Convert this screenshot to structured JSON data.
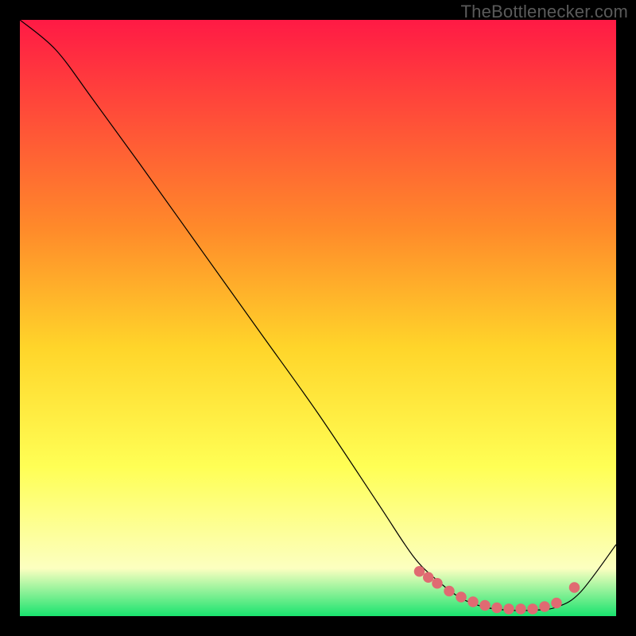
{
  "watermark": "TheBottlenecker.com",
  "colors": {
    "black": "#000000",
    "line": "#000000",
    "dot": "#e06a72",
    "grad_top": "#ff1a45",
    "grad_mid_upper": "#ff8a2a",
    "grad_mid": "#ffd52a",
    "grad_mid_lower": "#ffff55",
    "grad_low": "#fcffc0",
    "grad_bottom": "#19e36e"
  },
  "chart_data": {
    "type": "line",
    "title": "",
    "xlabel": "",
    "ylabel": "",
    "xlim": [
      0,
      100
    ],
    "ylim": [
      0,
      100
    ],
    "grid": false,
    "legend": false,
    "series": [
      {
        "name": "curve",
        "x": [
          0,
          6,
          12,
          20,
          30,
          40,
          50,
          60,
          66,
          70,
          74,
          78,
          82,
          86,
          90,
          94,
          100
        ],
        "y": [
          100,
          95,
          87,
          76,
          62,
          48,
          34,
          19,
          10,
          6,
          3,
          1.5,
          1,
          1,
          1.5,
          4,
          12
        ]
      }
    ],
    "markers": {
      "name": "dots",
      "x": [
        67,
        68.5,
        70,
        72,
        74,
        76,
        78,
        80,
        82,
        84,
        86,
        88,
        90,
        93
      ],
      "y": [
        7.5,
        6.5,
        5.5,
        4.2,
        3.2,
        2.4,
        1.8,
        1.4,
        1.2,
        1.2,
        1.2,
        1.6,
        2.2,
        4.8
      ]
    }
  }
}
